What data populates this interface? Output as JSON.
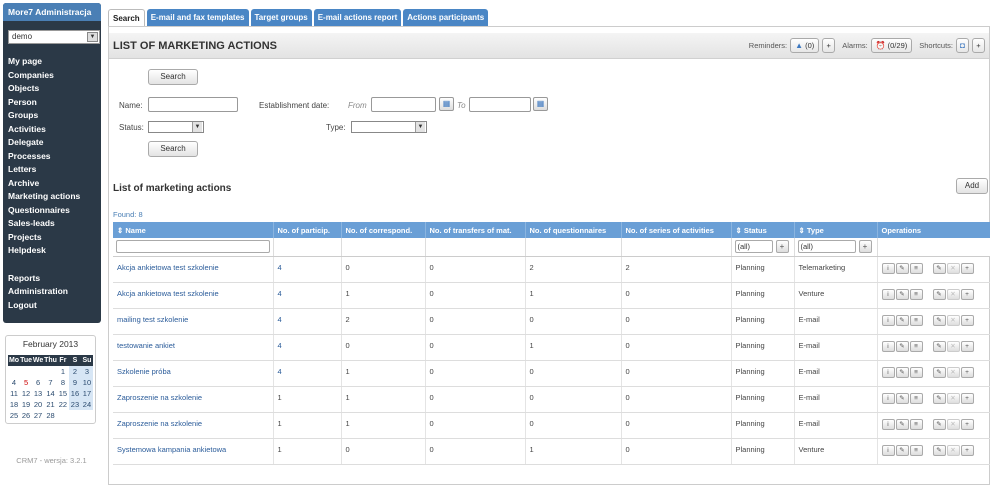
{
  "sidebar": {
    "title": "More7 Administracja",
    "account_select": "demo",
    "menu": [
      "My page",
      "Companies",
      "Objects",
      "Person",
      "Groups",
      "Activities",
      "Delegate",
      "Processes",
      "Letters",
      "Archive",
      "Marketing actions",
      "Questionnaires",
      "Sales-leads",
      "Projects",
      "Helpdesk"
    ],
    "menu2": [
      "Reports",
      "Administration",
      "Logout"
    ],
    "calendar": {
      "title": "February 2013",
      "weekdays": [
        "Mo",
        "Tue",
        "We",
        "Thu",
        "Fr",
        "S",
        "Su"
      ],
      "cells": [
        "",
        "",
        "",
        "",
        "1",
        "2",
        "3",
        "4",
        "5",
        "6",
        "7",
        "8",
        "9",
        "10",
        "11",
        "12",
        "13",
        "14",
        "15",
        "16",
        "17",
        "18",
        "19",
        "20",
        "21",
        "22",
        "23",
        "24",
        "25",
        "26",
        "27",
        "28",
        "",
        "",
        ""
      ],
      "today": "5"
    },
    "version": "CRM7 - wersja: 3.2.1"
  },
  "tabs": [
    "Search",
    "E-mail and fax templates",
    "Target groups",
    "E-mail actions report",
    "Actions participants"
  ],
  "header": {
    "title": "LIST OF MARKETING ACTIONS",
    "reminders_label": "Reminders:",
    "reminders_value": "(0)",
    "alarms_label": "Alarms:",
    "alarms_value": "(0/29)",
    "shortcuts_label": "Shortcuts:"
  },
  "search": {
    "button_label": "Search",
    "name_label": "Name:",
    "status_label": "Status:",
    "date_label": "Establishment date:",
    "from_label": "From",
    "to_label": "To",
    "type_label": "Type:"
  },
  "list": {
    "title": "List of marketing actions",
    "add_label": "Add",
    "found_label": "Found:",
    "found_count": "8",
    "columns": [
      "Name",
      "No. of particip.",
      "No. of correspond.",
      "No. of transfers of mat.",
      "No. of questionnaires",
      "No. of series of activities",
      "Status",
      "Type",
      "Operations"
    ],
    "filter_status": "(all)",
    "filter_type": "(all)",
    "rows": [
      [
        "Akcja ankietowa test szkolenie",
        "4",
        "0",
        "0",
        "2",
        "2",
        "Planning",
        "Telemarketing"
      ],
      [
        "Akcja ankietowa test szkolenie",
        "4",
        "1",
        "0",
        "1",
        "0",
        "Planning",
        "Venture"
      ],
      [
        "mailing test szkolenie",
        "4",
        "2",
        "0",
        "0",
        "0",
        "Planning",
        "E-mail"
      ],
      [
        "testowanie ankiet",
        "4",
        "0",
        "0",
        "1",
        "0",
        "Planning",
        "E-mail"
      ],
      [
        "Szkolenie próba",
        "4",
        "1",
        "0",
        "0",
        "0",
        "Planning",
        "E-mail"
      ],
      [
        "Zaproszenie na szkolenie",
        "1",
        "1",
        "0",
        "0",
        "0",
        "Planning",
        "E-mail"
      ],
      [
        "Zaproszenie na szkolenie",
        "1",
        "1",
        "0",
        "0",
        "0",
        "Planning",
        "E-mail"
      ],
      [
        "Systemowa kampania ankietowa",
        "1",
        "0",
        "0",
        "1",
        "0",
        "Planning",
        "Venture"
      ]
    ]
  }
}
